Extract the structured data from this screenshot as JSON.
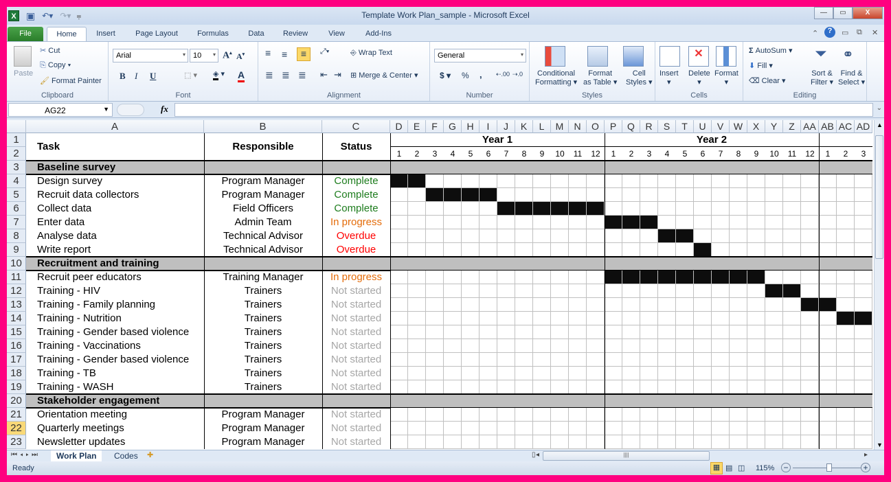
{
  "window": {
    "title": "Template Work Plan_sample  -  Microsoft Excel",
    "controls": {
      "minimize": "—",
      "restore": "▭",
      "close": "X"
    }
  },
  "ribbon_tabs": [
    "File",
    "Home",
    "Insert",
    "Page Layout",
    "Formulas",
    "Data",
    "Review",
    "View",
    "Add-Ins"
  ],
  "ribbon": {
    "clipboard": {
      "paste": "Paste",
      "cut": "Cut",
      "copy": "Copy",
      "format_painter": "Format Painter",
      "label": "Clipboard"
    },
    "font": {
      "name": "Arial",
      "size": "10",
      "label": "Font",
      "bold": "B",
      "italic": "I",
      "underline": "U"
    },
    "alignment": {
      "wrap_text": "Wrap Text",
      "merge_center": "Merge & Center",
      "label": "Alignment"
    },
    "number": {
      "format": "General",
      "currency": "$",
      "percent": "%",
      "comma": ",",
      "inc": ".00",
      "dec": ".0",
      "label": "Number"
    },
    "styles": {
      "conditional": "Conditional",
      "conditional2": "Formatting",
      "format_table": "Format",
      "format_table2": "as Table",
      "cell_styles": "Cell",
      "cell_styles2": "Styles",
      "label": "Styles"
    },
    "cells": {
      "insert": "Insert",
      "delete": "Delete",
      "format": "Format",
      "label": "Cells"
    },
    "editing": {
      "autosum": "AutoSum",
      "fill": "Fill",
      "clear": "Clear",
      "sort": "Sort &",
      "sort2": "Filter",
      "find": "Find &",
      "find2": "Select",
      "label": "Editing"
    }
  },
  "formula_bar": {
    "name_box": "AG22",
    "fx": "fx",
    "formula": ""
  },
  "columns": {
    "text": [
      "A",
      "B",
      "C"
    ],
    "gantt": [
      "D",
      "E",
      "F",
      "G",
      "H",
      "I",
      "J",
      "K",
      "L",
      "M",
      "N",
      "O",
      "P",
      "Q",
      "R",
      "S",
      "T",
      "U",
      "V",
      "W",
      "X",
      "Y",
      "Z",
      "AA",
      "AB",
      "AC",
      "AD"
    ]
  },
  "headers": {
    "task": "Task",
    "responsible": "Responsible",
    "status": "Status",
    "year1": "Year 1",
    "year2": "Year 2",
    "months": [
      "1",
      "2",
      "3",
      "4",
      "5",
      "6",
      "7",
      "8",
      "9",
      "10",
      "11",
      "12",
      "1",
      "2",
      "3",
      "4",
      "5",
      "6",
      "7",
      "8",
      "9",
      "10",
      "11",
      "12",
      "1",
      "2",
      "3"
    ]
  },
  "status_colors": {
    "Complete": "#1e7d1e",
    "In progress": "#e46c0a",
    "Overdue": "#ff0000",
    "Not started": "#a6a6a6"
  },
  "rows": [
    {
      "n": "3",
      "section": true,
      "task": "Baseline survey"
    },
    {
      "n": "4",
      "task": "Design survey",
      "responsible": "Program Manager",
      "status": "Complete",
      "bar": [
        0,
        1
      ]
    },
    {
      "n": "5",
      "task": "Recruit data collectors",
      "responsible": "Program Manager",
      "status": "Complete",
      "bar": [
        2,
        5
      ]
    },
    {
      "n": "6",
      "task": "Collect data",
      "responsible": "Field Officers",
      "status": "Complete",
      "bar": [
        6,
        11
      ]
    },
    {
      "n": "7",
      "task": "Enter data",
      "responsible": "Admin Team",
      "status": "In progress",
      "bar": [
        12,
        14
      ]
    },
    {
      "n": "8",
      "task": "Analyse data",
      "responsible": "Technical Advisor",
      "status": "Overdue",
      "bar": [
        15,
        16
      ]
    },
    {
      "n": "9",
      "task": "Write report",
      "responsible": "Technical Advisor",
      "status": "Overdue",
      "bar": [
        17,
        17
      ]
    },
    {
      "n": "10",
      "section": true,
      "task": "Recruitment and training"
    },
    {
      "n": "11",
      "task": "Recruit peer educators",
      "responsible": "Training Manager",
      "status": "In progress",
      "bar": [
        12,
        20
      ]
    },
    {
      "n": "12",
      "task": "Training - HIV",
      "responsible": "Trainers",
      "status": "Not started",
      "bar": [
        21,
        22
      ]
    },
    {
      "n": "13",
      "task": "Training - Family planning",
      "responsible": "Trainers",
      "status": "Not started",
      "bar": [
        23,
        24
      ]
    },
    {
      "n": "14",
      "task": "Training - Nutrition",
      "responsible": "Trainers",
      "status": "Not started",
      "bar": [
        25,
        26
      ]
    },
    {
      "n": "15",
      "task": "Training - Gender based violence",
      "responsible": "Trainers",
      "status": "Not started"
    },
    {
      "n": "16",
      "task": "Training - Vaccinations",
      "responsible": "Trainers",
      "status": "Not started"
    },
    {
      "n": "17",
      "task": "Training - Gender based violence",
      "responsible": "Trainers",
      "status": "Not started"
    },
    {
      "n": "18",
      "task": "Training - TB",
      "responsible": "Trainers",
      "status": "Not started"
    },
    {
      "n": "19",
      "task": "Training - WASH",
      "responsible": "Trainers",
      "status": "Not started"
    },
    {
      "n": "20",
      "section": true,
      "task": "Stakeholder engagement"
    },
    {
      "n": "21",
      "task": "Orientation meeting",
      "responsible": "Program Manager",
      "status": "Not started"
    },
    {
      "n": "22",
      "task": "Quarterly meetings",
      "responsible": "Program Manager",
      "status": "Not started",
      "selected": true
    },
    {
      "n": "23",
      "task": "Newsletter updates",
      "responsible": "Program Manager",
      "status": "Not started"
    }
  ],
  "sheet_tabs": [
    "Work Plan",
    "Codes"
  ],
  "active_sheet": "Work Plan",
  "status_bar": {
    "ready": "Ready",
    "zoom": "115%"
  }
}
